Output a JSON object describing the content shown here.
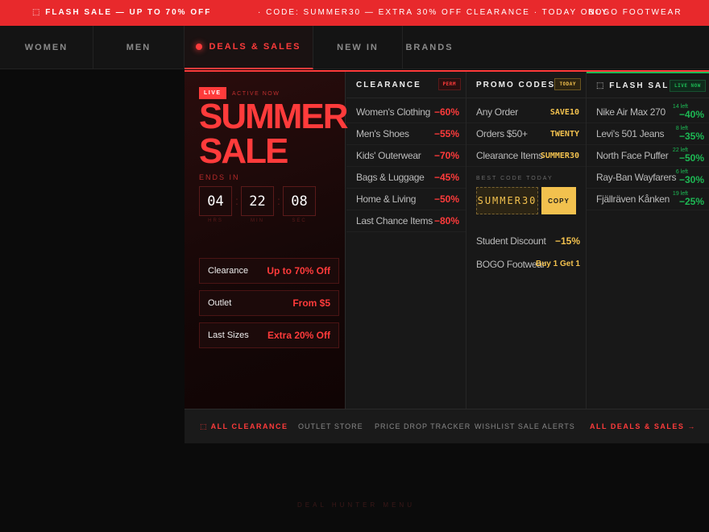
{
  "ticker": {
    "item1": "⬚ FLASH SALE — UP TO 70% OFF",
    "item2": "· CODE: SUMMER30 — EXTRA 30% OFF CLEARANCE · TODAY ONLY",
    "item3": "BOGO FOOTWEAR"
  },
  "nav": {
    "women": "WOMEN",
    "men": "MEN",
    "deals": "DEALS & SALES",
    "new_in": "NEW IN",
    "brands": "BRANDS"
  },
  "hero": {
    "live": "LIVE",
    "active_now": "ACTIVE NOW",
    "title_line1": "SUMMER",
    "title_line2": "SALE",
    "ends_in": "ENDS IN",
    "countdown": {
      "hours": "04",
      "minutes": "22",
      "seconds": "08",
      "hours_label": "HRS",
      "minutes_label": "MIN",
      "seconds_label": "SEC",
      "separator": ":"
    },
    "links": [
      {
        "name": "Clearance",
        "value": "Up to 70% Off"
      },
      {
        "name": "Outlet",
        "value": "From $5"
      },
      {
        "name": "Last Sizes",
        "value": "Extra 20% Off"
      }
    ]
  },
  "clearance": {
    "heading": "CLEARANCE",
    "tag": "PERM",
    "items": [
      {
        "name": "Women's Clothing",
        "value": "−60%"
      },
      {
        "name": "Men's Shoes",
        "value": "−55%"
      },
      {
        "name": "Kids' Outerwear",
        "value": "−70%"
      },
      {
        "name": "Bags & Luggage",
        "value": "−45%"
      },
      {
        "name": "Home & Living",
        "value": "−50%"
      },
      {
        "name": "Last Chance Items",
        "value": "−80%"
      }
    ]
  },
  "promo": {
    "heading": "PROMO CODES",
    "tag": "TODAY",
    "items": [
      {
        "name": "Any Order",
        "code": "SAVE10"
      },
      {
        "name": "Orders $50+",
        "code": "TWENTY"
      },
      {
        "name": "Clearance Items",
        "code": "SUMMER30"
      }
    ],
    "best_code_label": "BEST CODE TODAY",
    "best_code": "SUMMER30",
    "copy_label": "COPY",
    "extra": [
      {
        "name": "Student Discount",
        "value": "−15%"
      },
      {
        "name": "BOGO Footwear",
        "value": "Buy 1 Get 1"
      }
    ]
  },
  "flash": {
    "heading": "⬚ FLASH SALES",
    "tag": "LIVE NOW",
    "items": [
      {
        "name": "Nike Air Max 270",
        "left": "14 left",
        "value": "−40%"
      },
      {
        "name": "Levi's 501 Jeans",
        "left": "8 left",
        "value": "−35%"
      },
      {
        "name": "North Face Puffer",
        "left": "22 left",
        "value": "−50%"
      },
      {
        "name": "Ray-Ban Wayfarers",
        "left": "6 left",
        "value": "−30%"
      },
      {
        "name": "Fjällräven Kånken",
        "left": "19 left",
        "value": "−25%"
      }
    ]
  },
  "footer": {
    "all_clearance": "⬚ ALL CLEARANCE",
    "outlet": "OUTLET STORE",
    "price_drop": "PRICE DROP TRACKER",
    "wishlist": "WISHLIST SALE ALERTS",
    "all_deals": "ALL DEALS & SALES →"
  },
  "caption": "DEAL HUNTER MENU",
  "colors": {
    "accent": "#ff3b3b",
    "promo": "#f2c14e",
    "flash": "#1db954",
    "background": "#0b0b0b"
  }
}
